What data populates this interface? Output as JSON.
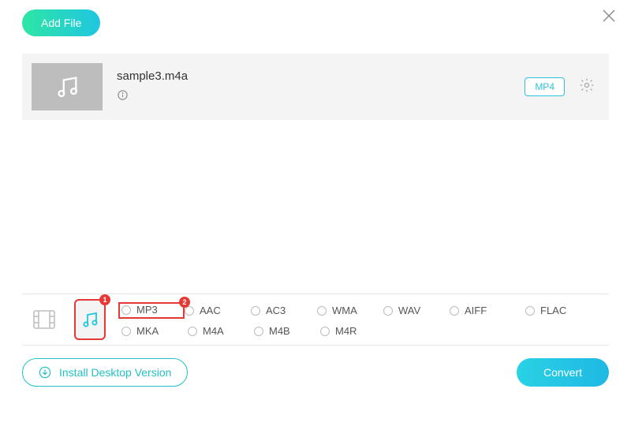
{
  "header": {
    "add_file_label": "Add File"
  },
  "file": {
    "name": "sample3.m4a",
    "output_format_label": "MP4"
  },
  "annotations": {
    "callout_music_tab": "1",
    "callout_mp3": "2"
  },
  "formats": {
    "row1": [
      {
        "id": "mp3",
        "label": "MP3"
      },
      {
        "id": "aac",
        "label": "AAC"
      },
      {
        "id": "ac3",
        "label": "AC3"
      },
      {
        "id": "wma",
        "label": "WMA"
      },
      {
        "id": "wav",
        "label": "WAV"
      },
      {
        "id": "aiff",
        "label": "AIFF"
      },
      {
        "id": "flac",
        "label": "FLAC"
      }
    ],
    "row2": [
      {
        "id": "mka",
        "label": "MKA"
      },
      {
        "id": "m4a",
        "label": "M4A"
      },
      {
        "id": "m4b",
        "label": "M4B"
      },
      {
        "id": "m4r",
        "label": "M4R"
      }
    ]
  },
  "footer": {
    "install_label": "Install Desktop Version",
    "convert_label": "Convert"
  }
}
